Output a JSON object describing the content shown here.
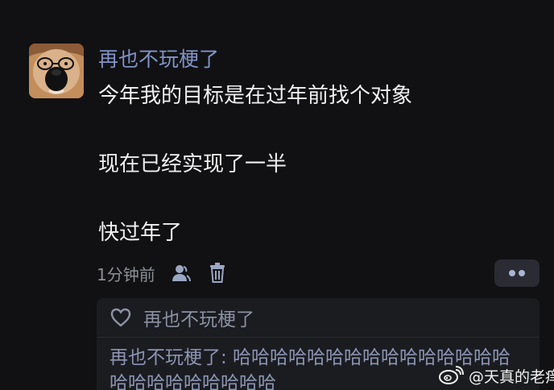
{
  "comment": {
    "author": "再也不玩梗了",
    "lines": [
      "今年我的目标是在过年前找个对象",
      "现在已经实现了一半",
      "快过年了"
    ],
    "time": "1分钟前"
  },
  "reply": {
    "name": "再也不玩梗了",
    "text": "再也不玩梗了: 哈哈哈哈哈哈哈哈哈哈哈哈哈哈哈哈哈哈哈哈哈哈哈哈"
  },
  "watermark": {
    "text": "@天真的老痒"
  },
  "icons": {
    "avatar": "shiba-dog-with-glasses",
    "user": "user-icon",
    "delete": "trash-icon",
    "more": "more-dots-icon",
    "like": "heart-icon",
    "watermark": "weibo-icon"
  },
  "colors": {
    "background": "#111113",
    "username": "#7f93c6",
    "body_text": "#f0f0f2",
    "meta_text": "#8d8f97",
    "reply_bg": "#1b1c20",
    "reply_text": "#8b94b3"
  }
}
